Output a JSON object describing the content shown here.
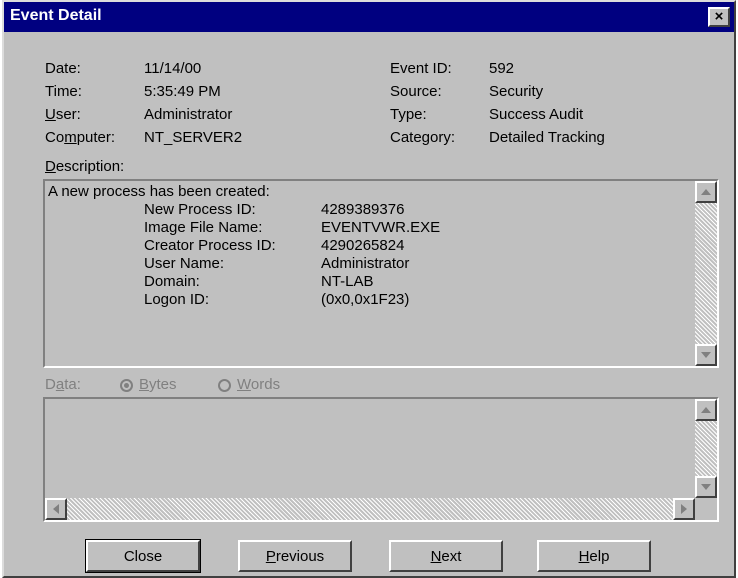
{
  "window": {
    "title": "Event Detail",
    "close_glyph": "×"
  },
  "fields": {
    "date_label": "Date:",
    "date_value": "11/14/00",
    "time_label": "Time:",
    "time_value": "5:35:49 PM",
    "user_label_u": "U",
    "user_label_rest": "ser:",
    "user_value": "Administrator",
    "computer_label_pre": "Co",
    "computer_label_u": "m",
    "computer_label_post": "puter:",
    "computer_value": "NT_SERVER2",
    "event_id_label": "Event ID:",
    "event_id_value": "592",
    "source_label": "Source:",
    "source_value": "Security",
    "type_label": "Type:",
    "type_value": "Success Audit",
    "category_label": "Category:",
    "category_value": "Detailed Tracking"
  },
  "description": {
    "label_u": "D",
    "label_rest": "escription:",
    "lines": [
      "A new process has been created:",
      "New Process ID:",
      "Image File Name:",
      "Creator Process ID:",
      "User Name:",
      "Domain:",
      "Logon ID:"
    ],
    "values": [
      "4289389376",
      "EVENTVWR.EXE",
      "4290265824",
      "Administrator",
      "NT-LAB",
      "(0x0,0x1F23)"
    ]
  },
  "data": {
    "label_pre": "D",
    "label_u": "a",
    "label_post": "ta:",
    "bytes_u": "B",
    "bytes_rest": "ytes",
    "words_u": "W",
    "words_rest": "ords",
    "selected": "Bytes"
  },
  "buttons": {
    "close": "Close",
    "previous_u": "P",
    "previous_rest": "revious",
    "next_u": "N",
    "next_rest": "ext",
    "help_u": "H",
    "help_rest": "elp"
  }
}
